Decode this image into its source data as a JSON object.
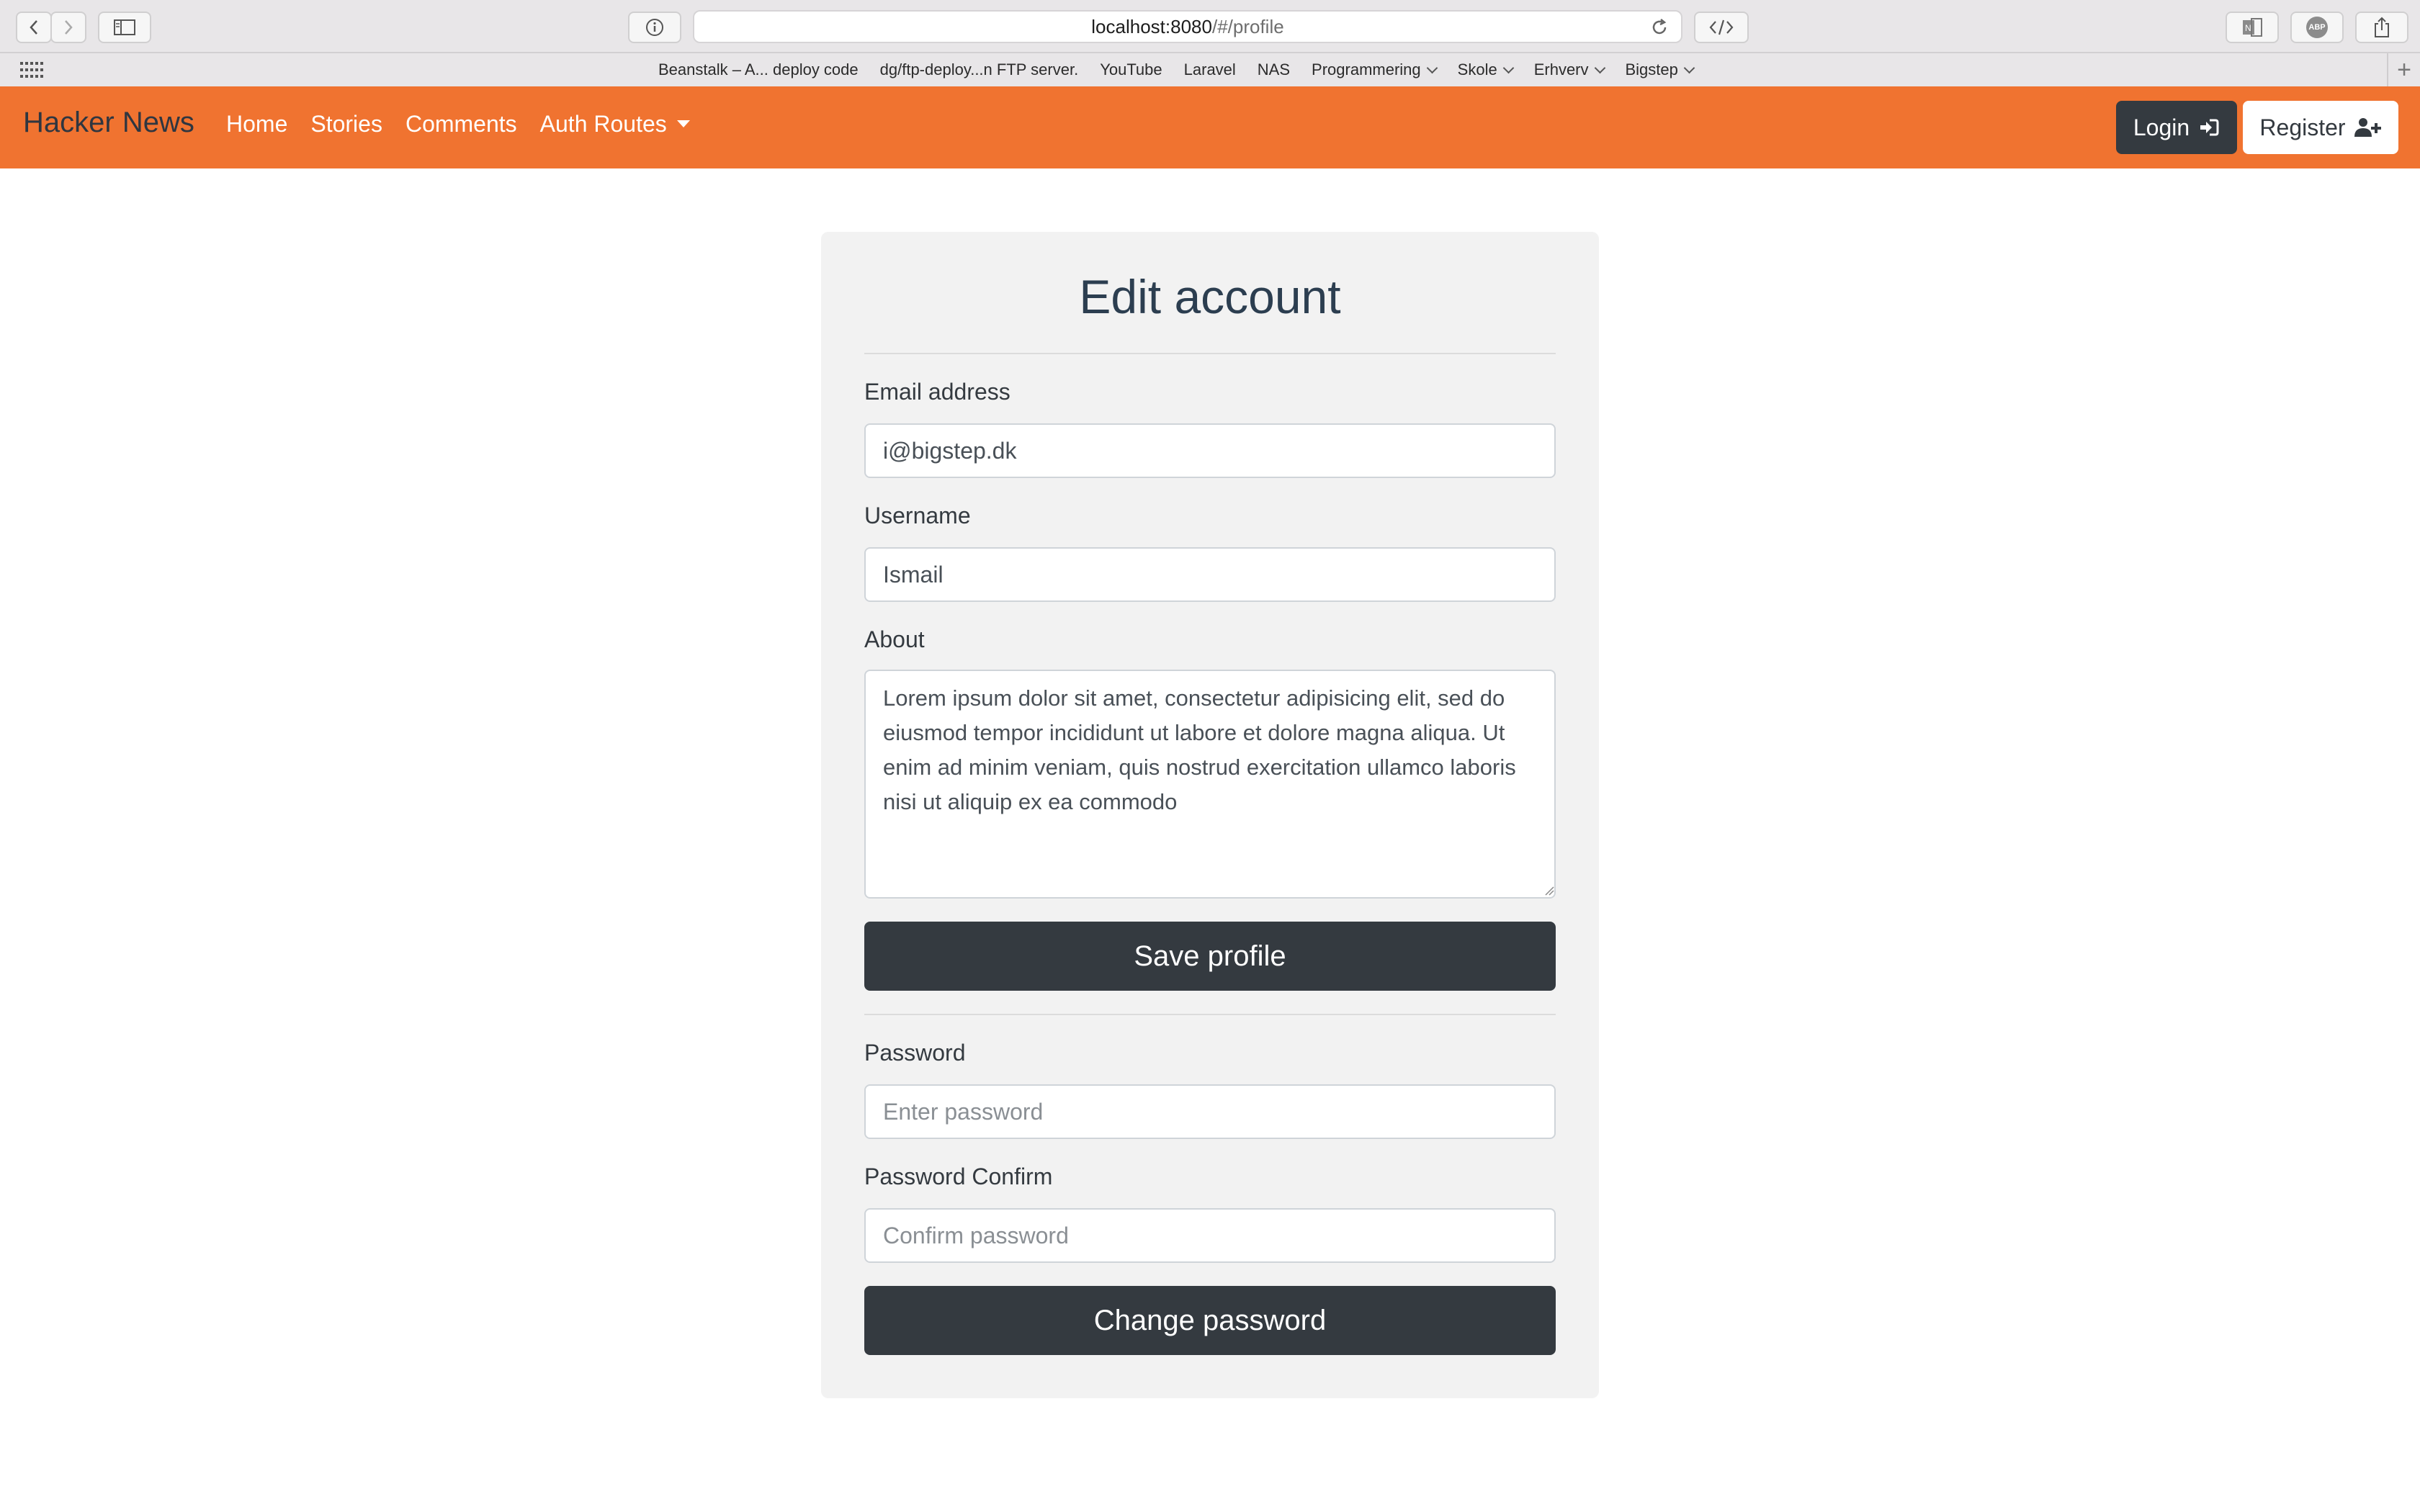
{
  "browser": {
    "url_host": "localhost:8080",
    "url_path": "/#/profile",
    "bookmarks": [
      {
        "label": "Beanstalk – A... deploy code",
        "dropdown": false
      },
      {
        "label": "dg/ftp-deploy...n FTP server.",
        "dropdown": false
      },
      {
        "label": "YouTube",
        "dropdown": false
      },
      {
        "label": "Laravel",
        "dropdown": false
      },
      {
        "label": "NAS",
        "dropdown": false
      },
      {
        "label": "Programmering",
        "dropdown": true
      },
      {
        "label": "Skole",
        "dropdown": true
      },
      {
        "label": "Erhverv",
        "dropdown": true
      },
      {
        "label": "Bigstep",
        "dropdown": true
      }
    ],
    "extension_badge": "ABP"
  },
  "navbar": {
    "brand": "Hacker News",
    "links": [
      "Home",
      "Stories",
      "Comments"
    ],
    "dropdown_label": "Auth Routes",
    "login_label": "Login",
    "register_label": "Register",
    "color": "#f07330"
  },
  "form": {
    "title": "Edit account",
    "email_label": "Email address",
    "email_value": "i@bigstep.dk",
    "username_label": "Username",
    "username_value": "Ismail",
    "about_label": "About",
    "about_value": "Lorem ipsum dolor sit amet, consectetur adipisicing elit, sed do eiusmod tempor incididunt ut labore et dolore magna aliqua. Ut enim ad minim veniam, quis nostrud exercitation ullamco laboris nisi ut aliquip ex ea commodo",
    "save_label": "Save profile",
    "password_label": "Password",
    "password_placeholder": "Enter password",
    "password_confirm_label": "Password Confirm",
    "password_confirm_placeholder": "Confirm password",
    "change_password_label": "Change password"
  }
}
